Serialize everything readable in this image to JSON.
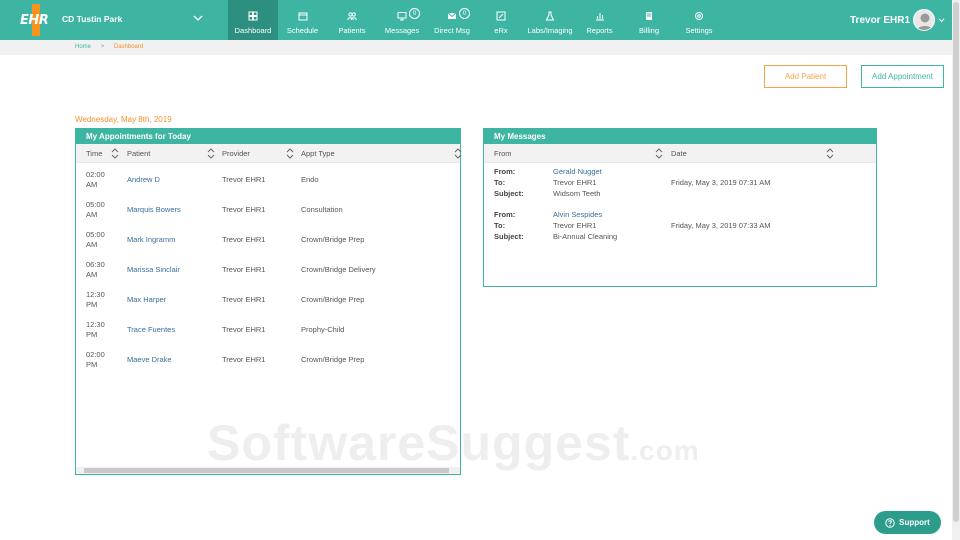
{
  "header": {
    "logo_text": "EHR",
    "practice_name": "CD Tustin Park",
    "user_name": "Trevor EHR1",
    "nav": [
      {
        "label": "Dashboard",
        "icon": "grid-icon",
        "active": true,
        "width": 50
      },
      {
        "label": "Schedule",
        "icon": "calendar-icon",
        "width": 49
      },
      {
        "label": "Patients",
        "icon": "users-icon",
        "width": 50
      },
      {
        "label": "Messages",
        "icon": "monitor-icon",
        "badge": "0",
        "width": 50
      },
      {
        "label": "Direct Msg",
        "icon": "envelope-icon",
        "badge": "0",
        "width": 50
      },
      {
        "label": "eRx",
        "icon": "edit-icon",
        "width": 48
      },
      {
        "label": "Labs/Imaging",
        "icon": "flask-icon",
        "width": 50
      },
      {
        "label": "Reports",
        "icon": "bar-chart-icon",
        "width": 49
      },
      {
        "label": "Billing",
        "icon": "file-icon",
        "width": 50
      },
      {
        "label": "Settings",
        "icon": "gear-icon",
        "width": 50
      }
    ]
  },
  "breadcrumb": {
    "home": "Home",
    "sep": ">",
    "current": "Dashboard"
  },
  "actions": {
    "add_patient": "Add Patient",
    "add_appointment": "Add Appointment"
  },
  "date_label": "Wednesday, May 8th, 2019",
  "appointments": {
    "title": "My Appointments for Today",
    "columns": {
      "time": "Time",
      "patient": "Patient",
      "provider": "Provider",
      "type": "Appt Type"
    },
    "rows": [
      {
        "time": "02:00 AM",
        "patient": "Andrew D",
        "provider": "Trevor EHR1",
        "type": "Endo"
      },
      {
        "time": "05:00 AM",
        "patient": "Marquis Bowers",
        "provider": "Trevor EHR1",
        "type": "Consultation"
      },
      {
        "time": "05:00 AM",
        "patient": "Mark Ingramm",
        "provider": "Trevor EHR1",
        "type": "Crown/Bridge Prep"
      },
      {
        "time": "06:30 AM",
        "patient": "Marissa Sinclair",
        "provider": "Trevor EHR1",
        "type": "Crown/Bridge Delivery"
      },
      {
        "time": "12:30 PM",
        "patient": "Max Harper",
        "provider": "Trevor EHR1",
        "type": "Crown/Bridge Prep"
      },
      {
        "time": "12:30 PM",
        "patient": "Trace Fuentes",
        "provider": "Trevor EHR1",
        "type": "Prophy-Child"
      },
      {
        "time": "02:00 PM",
        "patient": "Maeve Drake",
        "provider": "Trevor EHR1",
        "type": "Crown/Bridge Prep"
      }
    ]
  },
  "messages": {
    "title": "My Messages",
    "columns": {
      "from": "From",
      "date": "Date"
    },
    "labels": {
      "from": "From:",
      "to": "To:",
      "subject": "Subject:"
    },
    "items": [
      {
        "from": "Gerald Nugget",
        "to": "Trevor EHR1",
        "subject": "Widsom Teeth",
        "date": "Friday, May 3, 2019 07:31 AM"
      },
      {
        "from": "Alvin Sespides",
        "to": "Trevor EHR1",
        "subject": "Bi-Annual Cleaning",
        "date": "Friday, May 3, 2019 07:33 AM"
      }
    ]
  },
  "watermark": {
    "main": "SoftwareSuggest",
    "suffix": ".com"
  },
  "support_label": "Support",
  "colors": {
    "teal": "#3eb5a3",
    "teal_dark": "#2d8f80",
    "orange": "#f4a54a",
    "link": "#3a6e9c"
  }
}
